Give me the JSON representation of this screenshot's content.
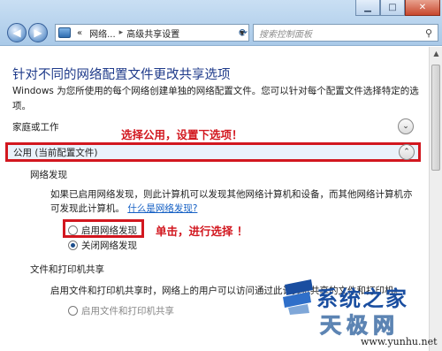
{
  "address_bar": {
    "prefix": "«",
    "crumbs": [
      "网络...",
      "高级共享设置"
    ],
    "separator": "▸"
  },
  "search": {
    "placeholder": "搜索控制面板"
  },
  "page": {
    "heading": "针对不同的网络配置文件更改共享选项",
    "description": "Windows 为您所使用的每个网络创建单独的网络配置文件。您可以针对每个配置文件选择特定的选项。"
  },
  "profiles": {
    "home": {
      "label": "家庭或工作"
    },
    "public": {
      "label": "公用 (当前配置文件)"
    }
  },
  "network_discovery": {
    "title": "网络发现",
    "text": "如果已启用网络发现，则此计算机可以发现其他网络计算机和设备，而其他网络计算机亦可发现此计算机。",
    "link": "什么是网络发现?",
    "options": [
      {
        "label": "启用网络发现",
        "checked": false
      },
      {
        "label": "关闭网络发现",
        "checked": true
      }
    ]
  },
  "file_printer_sharing": {
    "title": "文件和打印机共享",
    "text": "启用文件和打印机共享时，网络上的用户可以访问通过此计算机共享的文件和打印机。",
    "option": "启用文件和打印机共享"
  },
  "annotations": {
    "top": "选择公用，设置下选项！",
    "bottom": "单击，进行选择 ！"
  },
  "watermark": {
    "title": "系统之家",
    "subtitle": "天极网",
    "url": "www.yunhu.net"
  },
  "colors": {
    "annotation": "#d2171f",
    "heading": "#1e3a8a",
    "link": "#1560c4"
  }
}
